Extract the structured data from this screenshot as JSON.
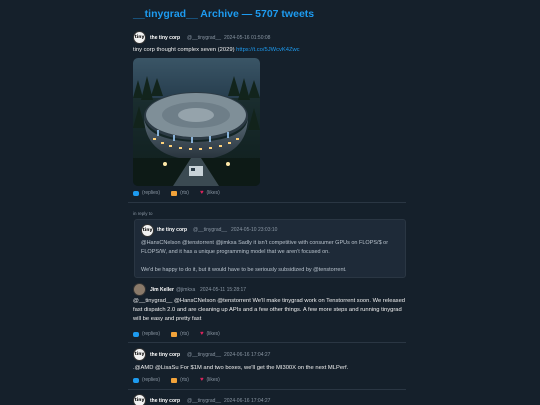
{
  "page": {
    "title": "__tinygrad__ Archive — 5707 tweets"
  },
  "tweets": [
    {
      "avatar": "tiny",
      "name": "the tiny corp",
      "handle": "@__tinygrad__",
      "time": "2024-05-16 01:50:08",
      "text": "tiny corp thought complex seven (2029) ",
      "link": "https://t.co/5JWcvK4Zwc",
      "actions": {
        "replies": "(replies)",
        "rts": "(rts)",
        "likes": "(likes)"
      }
    },
    {
      "in_reply_label": "in reply to",
      "quoted": {
        "avatar": "tiny",
        "name": "the tiny corp",
        "handle": "@__tinygrad__",
        "time": "2024-05-10 23:03:10",
        "text1": "@HansCNelson @tenstorrent @jimkxa Sadly it isn't competitive with consumer GPUs on FLOPS/$ or FLOPS/W, and it has a unique programming model that we aren't focused on.",
        "text2": "We'd be happy to do it, but it would have to be seriously subsidized by @tenstorrent."
      },
      "name": "Jim Keller",
      "handle": "@jimkxa",
      "time": "2024-05-11 15:28:17",
      "text": "@__tinygrad__ @HansCNelson @tenstorrent We'll make tinygrad work on Tenstorrent soon. We released fast dispatch 2.0 and are cleaning up APIs and a few other things. A few more steps and running tinygrad will be easy and pretty fast",
      "actions": {
        "replies": "(replies)",
        "rts": "(rts)",
        "likes": "(likes)"
      }
    },
    {
      "avatar": "tiny",
      "name": "the tiny corp",
      "handle": "@__tinygrad__",
      "time": "2024-06-16 17:04:27",
      "text": ".@AMD @LisaSu For $1M and two boxes, we'll get the MI300X on the next MLPerf.",
      "actions": {
        "replies": "(replies)",
        "rts": "(rts)",
        "likes": "(likes)"
      }
    },
    {
      "avatar": "tiny",
      "name": "the tiny corp",
      "handle": "@__tinygrad__",
      "time": "2024-06-16 17:04:27"
    }
  ],
  "colors": {
    "background": "#15202b",
    "accent": "#1d9bf0",
    "rt": "#f2a33a",
    "like": "#e0245e"
  },
  "icons": {
    "reply": "speech-bubble-icon",
    "retweet": "retweet-icon",
    "like": "heart-icon"
  }
}
